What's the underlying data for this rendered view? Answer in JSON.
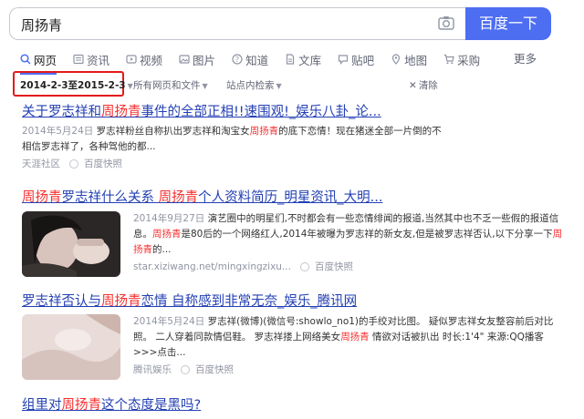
{
  "search": {
    "query": "周扬青",
    "button": "百度一下"
  },
  "tabs": [
    {
      "label": "网页",
      "icon": "search-icon"
    },
    {
      "label": "资讯",
      "icon": "news-icon"
    },
    {
      "label": "视频",
      "icon": "video-icon"
    },
    {
      "label": "图片",
      "icon": "image-icon"
    },
    {
      "label": "知道",
      "icon": "question-icon"
    },
    {
      "label": "文库",
      "icon": "document-icon"
    },
    {
      "label": "贴吧",
      "icon": "forum-icon"
    },
    {
      "label": "地图",
      "icon": "map-icon"
    },
    {
      "label": "采购",
      "icon": "cart-icon"
    }
  ],
  "more": "更多",
  "filters": {
    "date": "2014-2-3至2015-2-3",
    "type": "所有网页和文件",
    "site": "站点内检索",
    "clear": "清除"
  },
  "results": [
    {
      "title_a": "关于罗志祥和",
      "title_hl": "周扬青",
      "title_b": "事件的全部正相!!速围观!_娱乐八卦_论...",
      "date": "2014年5月24日",
      "snippet_a": " 罗志祥粉丝自称扒出罗志祥和淘宝女",
      "snippet_hl": "周扬青",
      "snippet_b": "的底下恋情！现在猪迷全部一片倒的不相信罗志祥了，各种驾他的都...",
      "source": "天涯社区",
      "snapshot": "百度快照"
    },
    {
      "title_hl1": "周扬青",
      "title_a": "罗志祥什么关系 ",
      "title_hl2": "周扬青",
      "title_b": "个人资料简历_明星资讯_大明...",
      "date": "2014年9月27日",
      "snippet_a": " 演艺圈中的明星们,不时都会有一些恋情绯闻的报道,当然其中也不乏一些假的报道信息。",
      "snippet_hl": "周扬青",
      "snippet_b": "是80后的一个网络红人,2014年被曝为罗志祥的新女友,但是被罗志祥否认,以下分享一下",
      "snippet_hl2": "周扬青",
      "snippet_c": "的...",
      "source": "star.xiziwang.net/mingxingzixu...",
      "snapshot": "百度快照"
    },
    {
      "title_a": "罗志祥否认与",
      "title_hl": "周扬青",
      "title_b": "恋情 自称感到非常无奈_娱乐_腾讯网",
      "date": "2014年5月24日",
      "snippet_a": " 罗志祥(微博)(微信号:showlo_no1)的手绞对比图。 疑似罗志祥女友整容前后对比照。 二人穿着同款情侣鞋。 罗志祥搂上网络美女",
      "snippet_hl": "周扬青",
      "snippet_b": " 情欲对话被扒出 时长:1'4\" 来源:QQ播客 >>>点击...",
      "source": "腾讯娱乐",
      "snapshot": "百度快照"
    },
    {
      "title_a": "组里对",
      "title_hl": "周扬青",
      "title_b": "这个态度是黑吗?"
    }
  ]
}
